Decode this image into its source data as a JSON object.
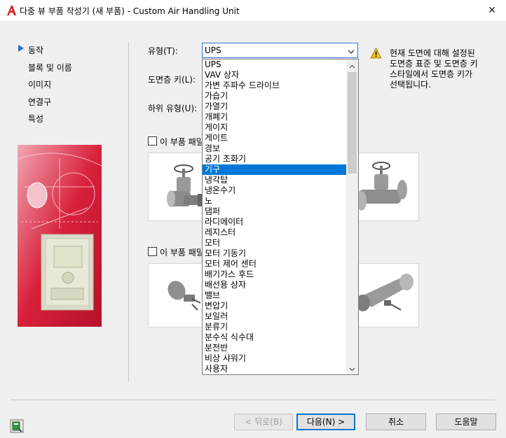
{
  "window": {
    "title": "다중 뷰 부품 작성기 (새 부품) - Custom Air Handling Unit",
    "close_glyph": "✕"
  },
  "nav": {
    "items": [
      {
        "label": "동작",
        "selected": true
      },
      {
        "label": "블록 및 이름"
      },
      {
        "label": "이미지"
      },
      {
        "label": "연결구"
      },
      {
        "label": "특성"
      }
    ]
  },
  "form": {
    "type_label": "유형(T):",
    "layer_key_label": "도면층 키(L):",
    "subtype_label": "하위 유형(U):",
    "type_value": "UPS",
    "checkbox1_label": "이 부품 패밀리",
    "checkbox2_label": "이 부품 패밀리"
  },
  "warning": {
    "text": "현재 도면에 대해 설정된\n도면층 표준 및 도면층 키\n스타일에서 도면층 키가\n선택됩니다."
  },
  "dropdown": {
    "selected_index": 10,
    "options": [
      "UPS",
      "VAV 상자",
      "가변 주파수 드라이브",
      "가습기",
      "가열기",
      "개폐기",
      "게이지",
      "게이트",
      "경보",
      "공기 조화기",
      "기구",
      "냉각탑",
      "냉온수기",
      "노",
      "댐퍼",
      "라디에이터",
      "레지스터",
      "모터",
      "모터 기동기",
      "모터 제어 센터",
      "배기가스 후드",
      "배선용 상자",
      "밸브",
      "변압기",
      "보일러",
      "분류기",
      "분수식 식수대",
      "분전반",
      "비상 샤워기",
      "사용자"
    ]
  },
  "buttons": {
    "back": "< 뒤로(B)",
    "next": "다음(N) >",
    "cancel": "취소",
    "help": "도움말"
  },
  "colors": {
    "accent": "#0078d7",
    "illustration_red": "#d8203a",
    "warning_yellow": "#f4c51c"
  }
}
